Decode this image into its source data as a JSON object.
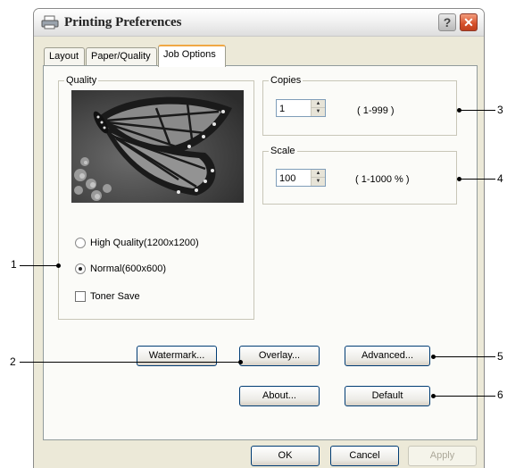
{
  "window": {
    "title": "Printing Preferences",
    "help_icon": "?",
    "close_icon": "✕"
  },
  "tabs": [
    {
      "label": "Layout",
      "active": false
    },
    {
      "label": "Paper/Quality",
      "active": false
    },
    {
      "label": "Job Options",
      "active": true
    }
  ],
  "quality": {
    "group_label": "Quality",
    "image": "butterfly-photo",
    "options": [
      {
        "label": "High Quality(1200x1200)",
        "selected": false
      },
      {
        "label": "Normal(600x600)",
        "selected": true
      }
    ],
    "toner_save": {
      "label": "Toner Save",
      "checked": false
    }
  },
  "copies": {
    "group_label": "Copies",
    "value": "1",
    "range": "( 1-999 )"
  },
  "scale": {
    "group_label": "Scale",
    "value": "100",
    "range": "( 1-1000 % )"
  },
  "buttons": {
    "watermark": "Watermark...",
    "overlay": "Overlay...",
    "advanced": "Advanced...",
    "about": "About...",
    "default": "Default"
  },
  "dialog_buttons": {
    "ok": "OK",
    "cancel": "Cancel",
    "apply": "Apply"
  },
  "callouts": [
    "1",
    "2",
    "3",
    "4",
    "5",
    "6"
  ]
}
